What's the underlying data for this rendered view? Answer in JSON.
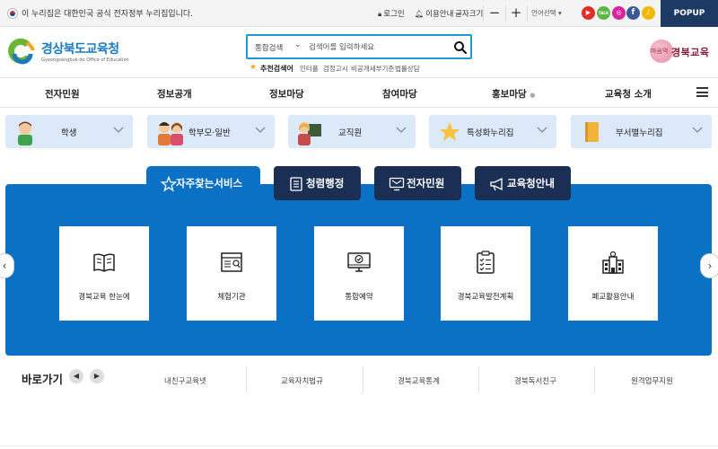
{
  "topbar": {
    "gov_notice": "이 누리집은 대한민국 공식 전자정부 누리집입니다.",
    "login": "로그인",
    "guide": "이용안내",
    "font_size": "글자크기",
    "zoom_out": "−",
    "zoom_in": "+",
    "language": "언어선택",
    "popup": "POPUP",
    "sns": [
      {
        "name": "youtube-icon",
        "color": "#e52d27",
        "glyph": "▶"
      },
      {
        "name": "talk-icon",
        "color": "#5bb645",
        "glyph": "TALK"
      },
      {
        "name": "instagram-icon",
        "color": "#d6249f",
        "glyph": "◎"
      },
      {
        "name": "facebook-icon",
        "color": "#3b5998",
        "glyph": "f"
      },
      {
        "name": "channel-icon",
        "color": "#f5b800",
        "glyph": "♪"
      }
    ]
  },
  "header": {
    "logo_title": "경상북도교육청",
    "logo_sub": "Gyeongsangbuk-do Office of Education",
    "search_category": "통합검색",
    "search_placeholder": "검색어를 입력하세요",
    "recommend_label": "추천검색어",
    "recommend_keywords": [
      "인터폴",
      "검정고시",
      "비공개세부기준",
      "법률상담"
    ],
    "brand_circle": "마음먹",
    "brand_text": "경북교육"
  },
  "nav": {
    "items": [
      "전자민원",
      "정보공개",
      "정보마당",
      "참여마당",
      "홍보마당",
      "교육청 소개"
    ]
  },
  "quick_tabs": [
    {
      "label": "학생"
    },
    {
      "label": "학부모·일반"
    },
    {
      "label": "교직원"
    },
    {
      "label": "특성화누리집"
    },
    {
      "label": "부서별누리집"
    }
  ],
  "service_tabs": [
    {
      "label": "자주찾는서비스",
      "active": true
    },
    {
      "label": "청렴행정",
      "active": false
    },
    {
      "label": "전자민원",
      "active": false
    },
    {
      "label": "교육청안내",
      "active": false
    }
  ],
  "cards": [
    {
      "label": "경북교육 한눈에",
      "icon": "book-icon"
    },
    {
      "label": "체험기관",
      "icon": "newspaper-icon"
    },
    {
      "label": "통합예약",
      "icon": "monitor-check-icon"
    },
    {
      "label": "경북교육발전계획",
      "icon": "checklist-icon"
    },
    {
      "label": "폐교활용안내",
      "icon": "school-building-icon"
    }
  ],
  "shortcuts": {
    "title": "바로가기",
    "items": [
      "내친구교육넷",
      "교육자치법규",
      "경북교육통계",
      "경북독서친구",
      "원격업무지원"
    ]
  },
  "colors": {
    "primary_blue": "#0b71c5",
    "navy": "#1b2f55",
    "tab_bg": "#dce9f8",
    "search_border": "#1b9ad4"
  }
}
